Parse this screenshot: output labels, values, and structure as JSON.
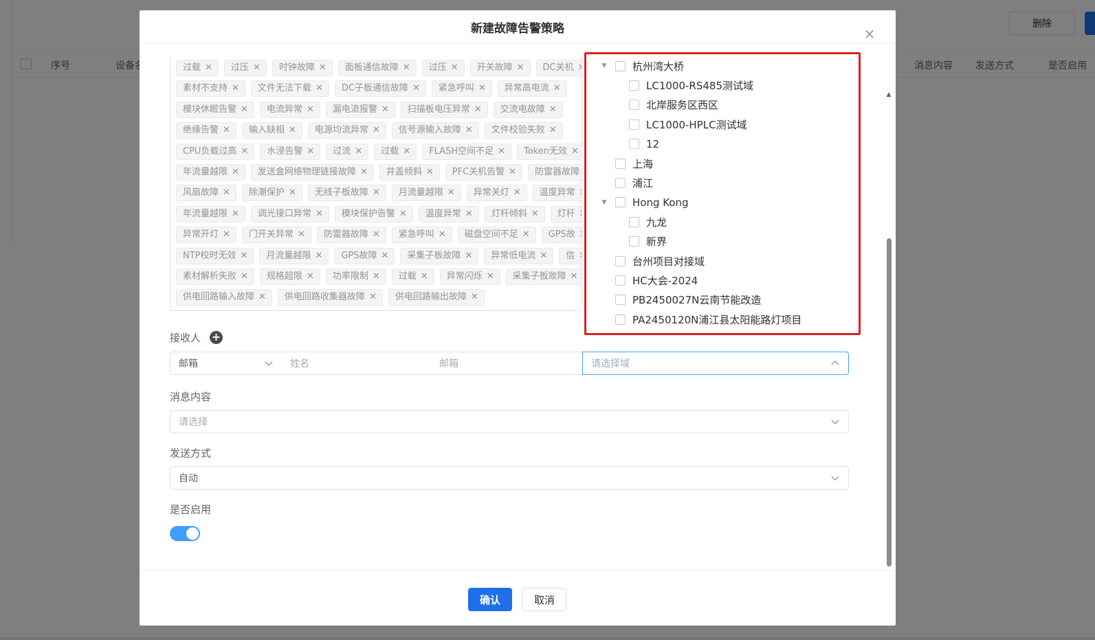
{
  "background": {
    "delete_label": "删除",
    "columns": [
      "序号",
      "设备名",
      "消息内容",
      "发送方式",
      "是否启用"
    ]
  },
  "dialog": {
    "title": "新建故障告警策略",
    "tag_rows": [
      [
        "过载",
        "过压",
        "时钟故障",
        "面板通信故障",
        "过压",
        "开关故障",
        "DC关机"
      ],
      [
        "素材不支持",
        "文件无法下载",
        "DC子板通信故障",
        "紧急呼叫",
        "异常高电流"
      ],
      [
        "模块休眠告警",
        "电流异常",
        "漏电流报警",
        "扫描板电压异常",
        "交流电故障"
      ],
      [
        "绝缘告警",
        "输入缺相",
        "电源均流异常",
        "信号源输入故障",
        "文件校验失败"
      ],
      [
        "CPU负载过高",
        "水浸告警",
        "过流",
        "过载",
        "FLASH空间不足",
        "Token无效"
      ],
      [
        "年流量越限",
        "发送盒网络物理链接故障",
        "井盖倾斜",
        "PFC关机告警",
        "防雷器故障"
      ],
      [
        "风扇故障",
        "除潮保护",
        "无线子板故障",
        "月流量越限",
        "异常关灯",
        "温度异常"
      ],
      [
        "年流量越限",
        "调光接口异常",
        "模块保护告警",
        "温度异常",
        "灯杆倾斜",
        "灯杆"
      ],
      [
        "异常开灯",
        "门开关异常",
        "防雷器故障",
        "紧急呼叫",
        "磁盘空间不足",
        "GPS故"
      ],
      [
        "NTP校时无效",
        "月流量越限",
        "GPS故障",
        "采集子板故障",
        "异常低电流",
        "信"
      ],
      [
        "素材解析失败",
        "规格超限",
        "功率限制",
        "过载",
        "异常闪烁",
        "采集子板故障"
      ],
      [
        "供电回路输入故障",
        "供电回路收集器故障",
        "供电回路输出故障"
      ]
    ],
    "receiver": {
      "label": "接收人",
      "type_value": "邮箱",
      "name_placeholder": "姓名",
      "email_placeholder": "邮箱",
      "domain_placeholder": "请选择域"
    },
    "message": {
      "label": "消息内容",
      "placeholder": "请选择"
    },
    "send_method": {
      "label": "发送方式",
      "value": "自动"
    },
    "enabled": {
      "label": "是否启用",
      "value": true
    },
    "confirm_label": "确认",
    "cancel_label": "取消"
  },
  "domain_tree": [
    {
      "label": "杭州湾大桥",
      "level": 0,
      "expanded": true
    },
    {
      "label": "LC1000-RS485测试域",
      "level": 1
    },
    {
      "label": "北岸服务区西区",
      "level": 1
    },
    {
      "label": "LC1000-HPLC测试域",
      "level": 1
    },
    {
      "label": "12",
      "level": 1
    },
    {
      "label": "上海",
      "level": 0
    },
    {
      "label": "浦江",
      "level": 0
    },
    {
      "label": "Hong Kong",
      "level": 0,
      "expanded": true
    },
    {
      "label": "九龙",
      "level": 1
    },
    {
      "label": "新界",
      "level": 1
    },
    {
      "label": "台州项目对接域",
      "level": 0
    },
    {
      "label": "HC大会-2024",
      "level": 0
    },
    {
      "label": "PB2450027N云南节能改造",
      "level": 0
    },
    {
      "label": "PA2450120N浦江县太阳能路灯项目",
      "level": 0
    }
  ],
  "colors": {
    "primary": "#1f6feb",
    "toggle_on": "#409eff",
    "highlight_border": "#e02020"
  }
}
